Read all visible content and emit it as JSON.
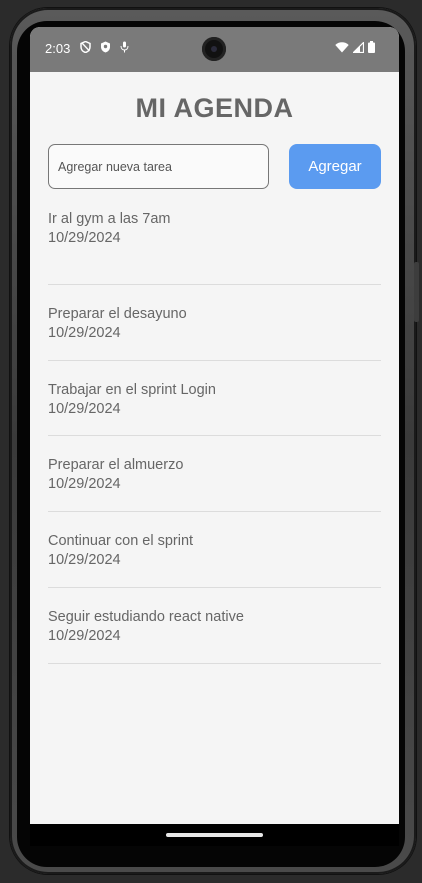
{
  "status_bar": {
    "time": "2:03",
    "left_icons": [
      "shield-outline-icon",
      "shield-filled-icon",
      "mic-icon"
    ],
    "right_icons": [
      "wifi-icon",
      "signal-icon",
      "battery-icon"
    ]
  },
  "app": {
    "title": "MI AGENDA",
    "input": {
      "placeholder": "Agregar nueva tarea",
      "value": ""
    },
    "add_button_label": "Agregar",
    "accent_color": "#5b9bf0"
  },
  "tasks": [
    {
      "name": "Ir al gym a las 7am",
      "date": "10/29/2024"
    },
    {
      "name": "Preparar el desayuno",
      "date": "10/29/2024"
    },
    {
      "name": "Trabajar en el sprint Login",
      "date": "10/29/2024"
    },
    {
      "name": "Preparar el almuerzo",
      "date": "10/29/2024"
    },
    {
      "name": "Continuar con el sprint",
      "date": "10/29/2024"
    },
    {
      "name": "Seguir estudiando react native",
      "date": "10/29/2024"
    }
  ]
}
